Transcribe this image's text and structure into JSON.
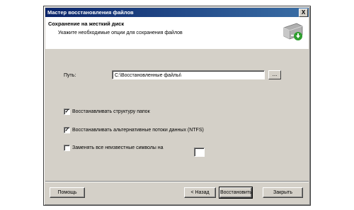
{
  "window": {
    "title": "Мастер восстановления файлов",
    "close_label": "X"
  },
  "header": {
    "title": "Сохранение на жесткий диск",
    "subtitle": "Укажите необходимые опции для сохранения файлов",
    "icon": "hard-drive-icon"
  },
  "path": {
    "label": "Путь:",
    "value": "C:\\Восстановленные файлы\\",
    "browse_label": "..."
  },
  "options": [
    {
      "label": "Восстанавливать структуру папок",
      "checked": true
    },
    {
      "label": "Восстанавливать альтернативные потоки данных (NTFS)",
      "checked": true
    },
    {
      "label": "Заменять все неизвестные символы на",
      "checked": false
    }
  ],
  "replace_char": {
    "value": ""
  },
  "buttons": {
    "help": "Помощь",
    "back": "< Назад",
    "restore": "Восстановить",
    "close": "Закрыть"
  },
  "colors": {
    "titlebar": "#0a246a",
    "face": "#d4d0c8",
    "accent_green": "#2e9e2e"
  }
}
